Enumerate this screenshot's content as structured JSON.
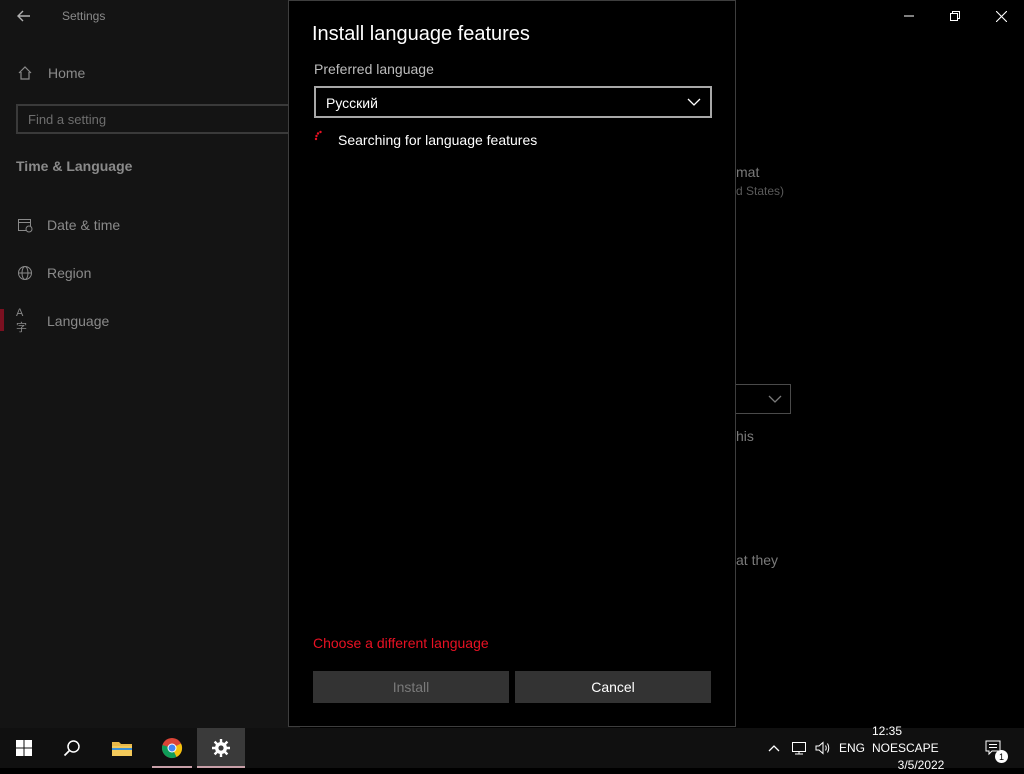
{
  "settings": {
    "window_title": "Settings",
    "home_label": "Home",
    "search_placeholder": "Find a setting",
    "section_title": "Time & Language",
    "nav": [
      {
        "label": "Date & time"
      },
      {
        "label": "Region"
      },
      {
        "label": "Language"
      }
    ],
    "background_fragments": {
      "format": "mat",
      "region": "d States)",
      "this": "his",
      "that_they": "at they"
    }
  },
  "dialog": {
    "title": "Install language features",
    "preferred_label": "Preferred language",
    "selected_language": "Русский",
    "status": "Searching for language features",
    "choose_link": "Choose a different language",
    "install_label": "Install",
    "cancel_label": "Cancel"
  },
  "taskbar": {
    "language": "ENG",
    "time": "12:35 NOESCAPE",
    "date": "3/5/2022",
    "notification_count": "1"
  },
  "colors": {
    "accent": "#e81123",
    "background": "#000000",
    "sidebar": "#141414",
    "button": "#333333"
  }
}
